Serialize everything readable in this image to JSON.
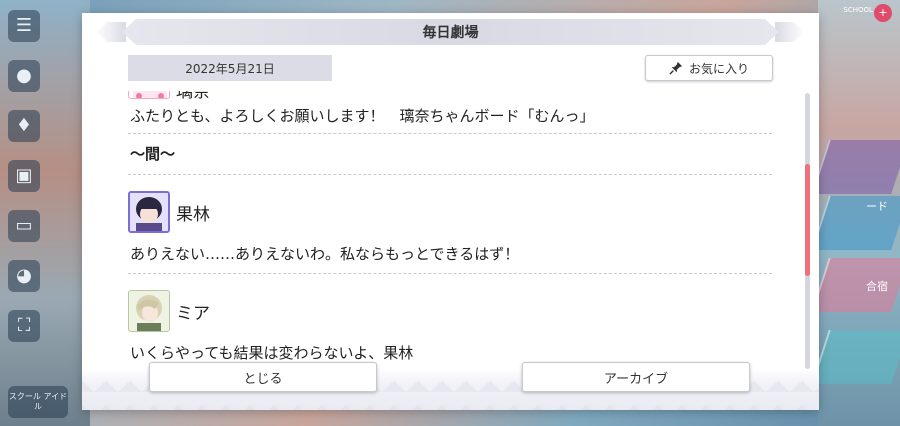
{
  "dialog": {
    "title": "毎日劇場",
    "date": "2022年5月21日",
    "favorite_label": "お気に入り"
  },
  "messages": [
    {
      "speaker": "璃奈",
      "text": "ふたりとも、よろしくお願いします！　璃奈ちゃんボード「むんっ」"
    },
    {
      "speaker": "",
      "text": "〜間〜"
    },
    {
      "speaker": "果林",
      "text": "ありえない……ありえないわ。私ならもっとできるはず！"
    },
    {
      "speaker": "ミア",
      "text": "いくらやっても結果は変わらないよ、果林"
    }
  ],
  "footer": {
    "close_label": "とじる",
    "archive_label": "アーカイブ"
  },
  "background": {
    "tile_label_1": "ード",
    "tile_label_2": "合宿",
    "bottom_left_label": "スクール アイドル",
    "top_right_label": "SCHOOL IDOL"
  },
  "scroll": {
    "position_fraction": 0.43
  },
  "colors": {
    "accent": "#ee6f7f",
    "title_bg": "#d9d9e4",
    "date_bg": "#dcdce6"
  }
}
